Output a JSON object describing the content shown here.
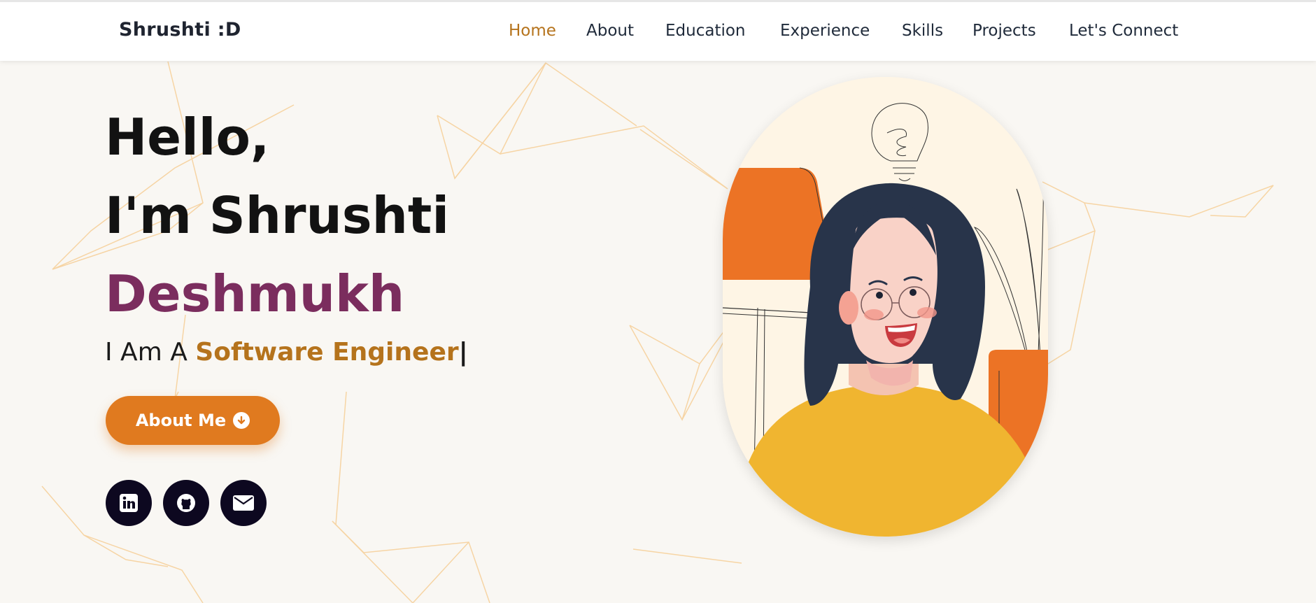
{
  "brand": {
    "name": "Shrushti :D"
  },
  "nav": {
    "items": [
      {
        "label": "Home",
        "active": true
      },
      {
        "label": "About",
        "active": false
      },
      {
        "label": "Education",
        "active": false
      },
      {
        "label": "Experience",
        "active": false
      },
      {
        "label": "Skills",
        "active": false
      },
      {
        "label": "Projects",
        "active": false
      },
      {
        "label": "Let's Connect",
        "active": false
      }
    ]
  },
  "hero": {
    "greeting": "Hello,",
    "name_line": "I'm Shrushti",
    "surname": "Deshmukh",
    "role_prefix": "I Am A",
    "role": "Software Engineer",
    "caret": "|",
    "cta_label": "About Me",
    "cta_icon": "arrow-down-circle-icon"
  },
  "socials": [
    {
      "name": "linkedin-icon"
    },
    {
      "name": "github-icon"
    },
    {
      "name": "email-icon"
    }
  ],
  "colors": {
    "accent": "#b5731c",
    "name_accent": "#7b2d5e",
    "button": "#e07a1f",
    "social_bg": "#0d0820",
    "background": "#f9f7f3"
  }
}
